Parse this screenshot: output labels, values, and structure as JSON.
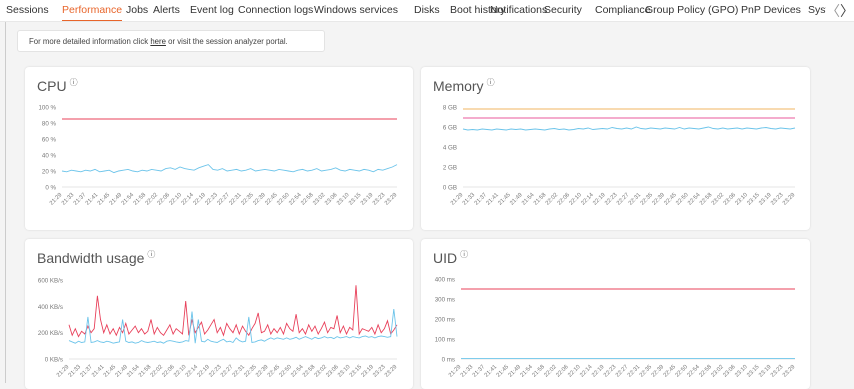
{
  "tabs": [
    {
      "label": "Sessions",
      "active": false
    },
    {
      "label": "Performance",
      "active": true
    },
    {
      "label": "Jobs",
      "active": false
    },
    {
      "label": "Alerts",
      "active": false
    },
    {
      "label": "Event log",
      "active": false
    },
    {
      "label": "Connection logs",
      "active": false
    },
    {
      "label": "Windows services",
      "active": false
    },
    {
      "label": "Disks",
      "active": false
    },
    {
      "label": "Boot history",
      "active": false
    },
    {
      "label": "Notifications",
      "active": false
    },
    {
      "label": "Security",
      "active": false
    },
    {
      "label": "Compliance",
      "active": false
    },
    {
      "label": "Group Policy (GPO)",
      "active": false
    },
    {
      "label": "PnP Devices",
      "active": false
    },
    {
      "label": "Syste",
      "active": false
    }
  ],
  "nav": {
    "prev_icon": "chevron-left-icon",
    "next_icon": "chevron-right-icon",
    "prev_glyph": "〈",
    "next_glyph": "〉"
  },
  "info": {
    "prefix": "For more detailed information click ",
    "link": "here",
    "suffix": " or visit the session analyzer portal."
  },
  "colors": {
    "threshold": "#e8405a",
    "threshold_orange": "#f2b660",
    "threshold_pink": "#e85a9b",
    "series": "#6cc4ea",
    "axis_text": "#777",
    "grid": "#e5e5e5"
  },
  "x_labels": [
    "21:29",
    "21:33",
    "21:37",
    "21:41",
    "21:45",
    "21:49",
    "21:54",
    "21:58",
    "22:02",
    "22:06",
    "22:10",
    "22:14",
    "22:19",
    "22:23",
    "22:27",
    "22:31",
    "22:35",
    "22:39",
    "22:45",
    "22:50",
    "22:54",
    "22:58",
    "23:02",
    "23:06",
    "23:10",
    "23:15",
    "23:19",
    "23:23",
    "23:29"
  ],
  "chart_data": [
    {
      "type": "line",
      "title": "CPU",
      "info_icon": "ⓘ",
      "y_ticks": [
        "100 %",
        "80 %",
        "60 %",
        "40 %",
        "20 %",
        "0 %"
      ],
      "ylim": [
        0,
        100
      ],
      "thresholds": [
        {
          "value": 85,
          "color": "#e8405a"
        }
      ],
      "series": [
        {
          "values": [
            20,
            19,
            21,
            20,
            19,
            21,
            20,
            22,
            19,
            20,
            21,
            18,
            20,
            21,
            22,
            20,
            19,
            21,
            20,
            22,
            21,
            20,
            23,
            24,
            22,
            25,
            23,
            22,
            21,
            24,
            26,
            28,
            22,
            21,
            23,
            20,
            21,
            22,
            20,
            21,
            23,
            20,
            21,
            22,
            21,
            20,
            22,
            21,
            20,
            19,
            21,
            22,
            20,
            21,
            23,
            20,
            21,
            22,
            24,
            21,
            20,
            22,
            21,
            20,
            22,
            21,
            19,
            22,
            21,
            23,
            25,
            28
          ]
        }
      ]
    },
    {
      "type": "line",
      "title": "Memory",
      "info_icon": "ⓘ",
      "y_ticks": [
        "8 GB",
        "6 GB",
        "4 GB",
        "2 GB",
        "0 GB"
      ],
      "ylim": [
        0,
        8
      ],
      "thresholds": [
        {
          "value": 7.8,
          "color": "#f2b660"
        },
        {
          "value": 6.9,
          "color": "#e85a9b"
        }
      ],
      "series": [
        {
          "values": [
            5.8,
            5.7,
            5.75,
            5.7,
            5.8,
            5.75,
            5.7,
            5.8,
            5.75,
            5.7,
            5.8,
            5.75,
            5.8,
            5.7,
            5.75,
            5.8,
            5.75,
            5.7,
            5.8,
            5.85,
            5.75,
            5.8,
            5.7,
            5.75,
            5.85,
            5.8,
            5.9,
            5.75,
            5.8,
            5.85,
            5.8,
            5.95,
            5.85,
            5.8,
            5.9,
            5.8,
            6.0,
            5.85,
            5.8,
            5.9,
            5.85,
            5.8,
            5.9,
            5.85,
            5.8,
            5.95,
            5.8,
            5.9,
            5.85,
            5.8,
            5.9,
            6.0,
            5.85,
            5.8,
            5.9,
            5.8,
            5.85,
            5.9,
            5.8,
            5.9,
            5.85,
            5.8,
            5.9,
            5.95,
            5.85,
            5.8,
            5.9,
            5.85,
            5.8,
            5.9
          ]
        }
      ]
    },
    {
      "type": "line",
      "title": "Bandwidth usage",
      "info_icon": "ⓘ",
      "y_ticks": [
        "600 KB/s",
        "400 KB/s",
        "200 KB/s",
        "0 KB/s"
      ],
      "ylim": [
        0,
        600
      ],
      "thresholds": [],
      "series": [
        {
          "color": "#e8405a",
          "values": [
            260,
            180,
            230,
            170,
            210,
            190,
            250,
            200,
            230,
            480,
            300,
            200,
            260,
            190,
            230,
            180,
            240,
            200,
            270,
            190,
            220,
            250,
            200,
            230,
            190,
            210,
            300,
            190,
            240,
            200,
            180,
            220,
            260,
            190,
            230,
            210,
            190,
            440,
            180,
            300,
            200,
            240,
            280,
            190,
            220,
            260,
            300,
            200,
            240,
            180,
            270,
            230,
            200,
            260,
            190,
            250,
            210,
            180,
            230,
            270,
            350,
            200,
            210,
            260,
            190,
            230,
            200,
            240,
            190,
            270,
            230,
            210,
            340,
            200,
            230,
            190,
            260,
            210,
            250,
            190,
            230,
            280,
            200,
            240,
            230,
            330,
            200,
            250,
            190,
            240,
            220,
            560,
            190,
            230,
            220,
            210,
            240,
            190,
            260,
            200,
            230,
            290,
            190,
            220,
            260
          ]
        },
        {
          "color": "#6cc4ea",
          "values": [
            140,
            130,
            120,
            135,
            125,
            130,
            320,
            125,
            130,
            140,
            130,
            125,
            135,
            130,
            120,
            125,
            130,
            300,
            135,
            125,
            130,
            120,
            125,
            140,
            130,
            125,
            130,
            135,
            125,
            130,
            120,
            135,
            140,
            135,
            130,
            125,
            130,
            140,
            135,
            360,
            120,
            300,
            135,
            130,
            150,
            135,
            130,
            125,
            140,
            150,
            130,
            135,
            125,
            160,
            140,
            130,
            135,
            320,
            125,
            130,
            140,
            145,
            135,
            150,
            160,
            150,
            160,
            155,
            150,
            160,
            150,
            155,
            165,
            150,
            160,
            170,
            160,
            150,
            165,
            155,
            160,
            170,
            160,
            165,
            155,
            170,
            160,
            165,
            170,
            160,
            170,
            165,
            160,
            170,
            175,
            165,
            170,
            160,
            170,
            175,
            170,
            165,
            170,
            380,
            170
          ]
        }
      ]
    },
    {
      "type": "line",
      "title": "UID",
      "info_icon": "ⓘ",
      "y_ticks": [
        "400 ms",
        "300 ms",
        "200 ms",
        "100 ms",
        "0 ms"
      ],
      "ylim": [
        0,
        400
      ],
      "thresholds": [
        {
          "value": 350,
          "color": "#e8405a"
        }
      ],
      "series": [
        {
          "values": [
            2,
            2,
            2,
            2,
            2,
            2,
            2,
            2,
            2,
            2,
            2,
            2,
            2,
            2,
            2,
            2,
            2,
            2,
            2,
            2
          ]
        }
      ]
    }
  ]
}
